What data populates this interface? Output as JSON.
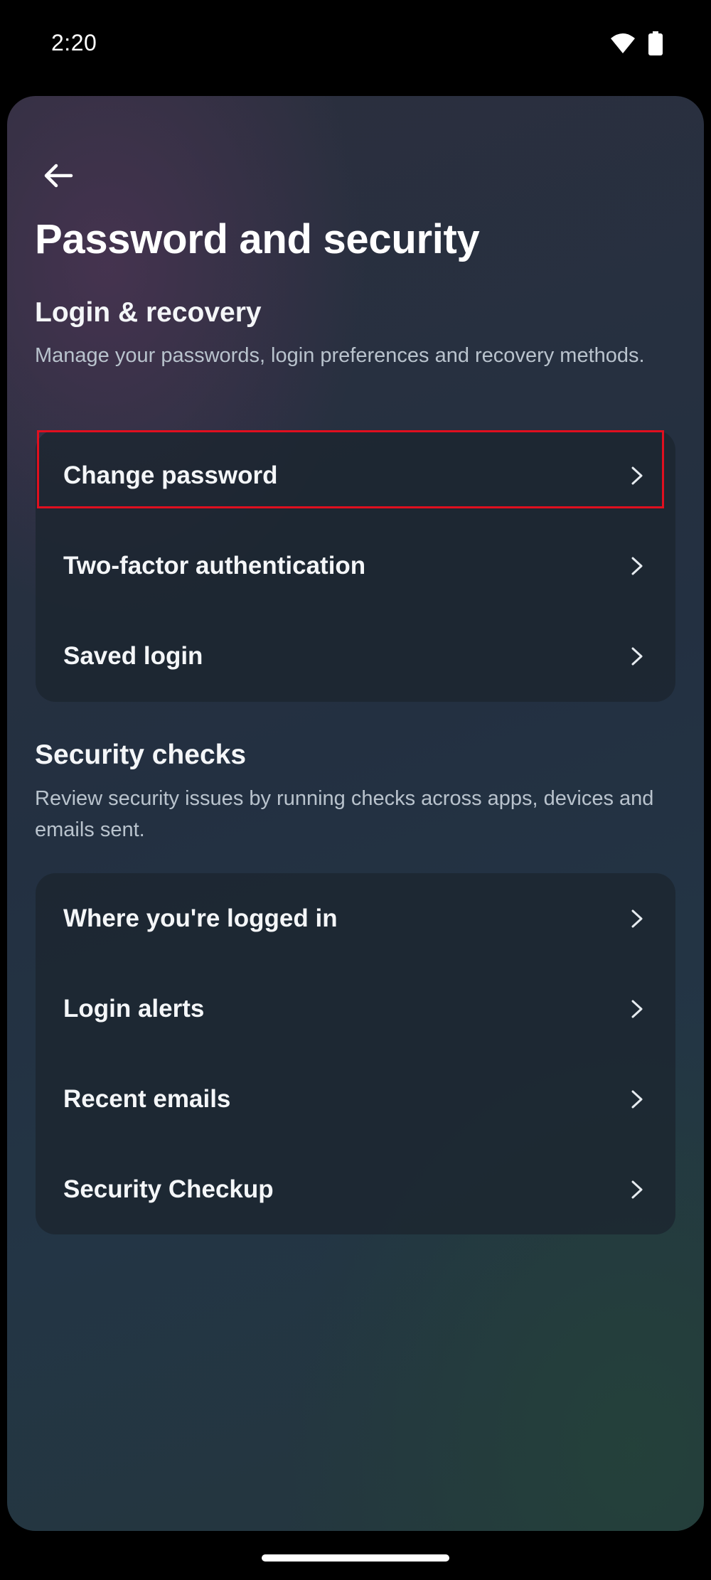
{
  "status_bar": {
    "time": "2:20",
    "icons": [
      "wifi-icon",
      "battery-icon"
    ]
  },
  "header": {
    "back_icon": "arrow-left-icon",
    "title": "Password and security"
  },
  "login_recovery": {
    "heading": "Login & recovery",
    "description": "Manage your passwords, login preferences and recovery methods.",
    "items": [
      {
        "label": "Change password"
      },
      {
        "label": "Two-factor authentication",
        "highlighted": true
      },
      {
        "label": "Saved login"
      }
    ]
  },
  "security_checks": {
    "heading": "Security checks",
    "description": "Review security issues by running checks across apps, devices and emails sent.",
    "items": [
      {
        "label": "Where you're logged in"
      },
      {
        "label": "Login alerts"
      },
      {
        "label": "Recent emails"
      },
      {
        "label": "Security Checkup"
      }
    ]
  },
  "colors": {
    "highlight_border": "#e00f1f",
    "background": "#233041",
    "card": "#1c2630"
  }
}
